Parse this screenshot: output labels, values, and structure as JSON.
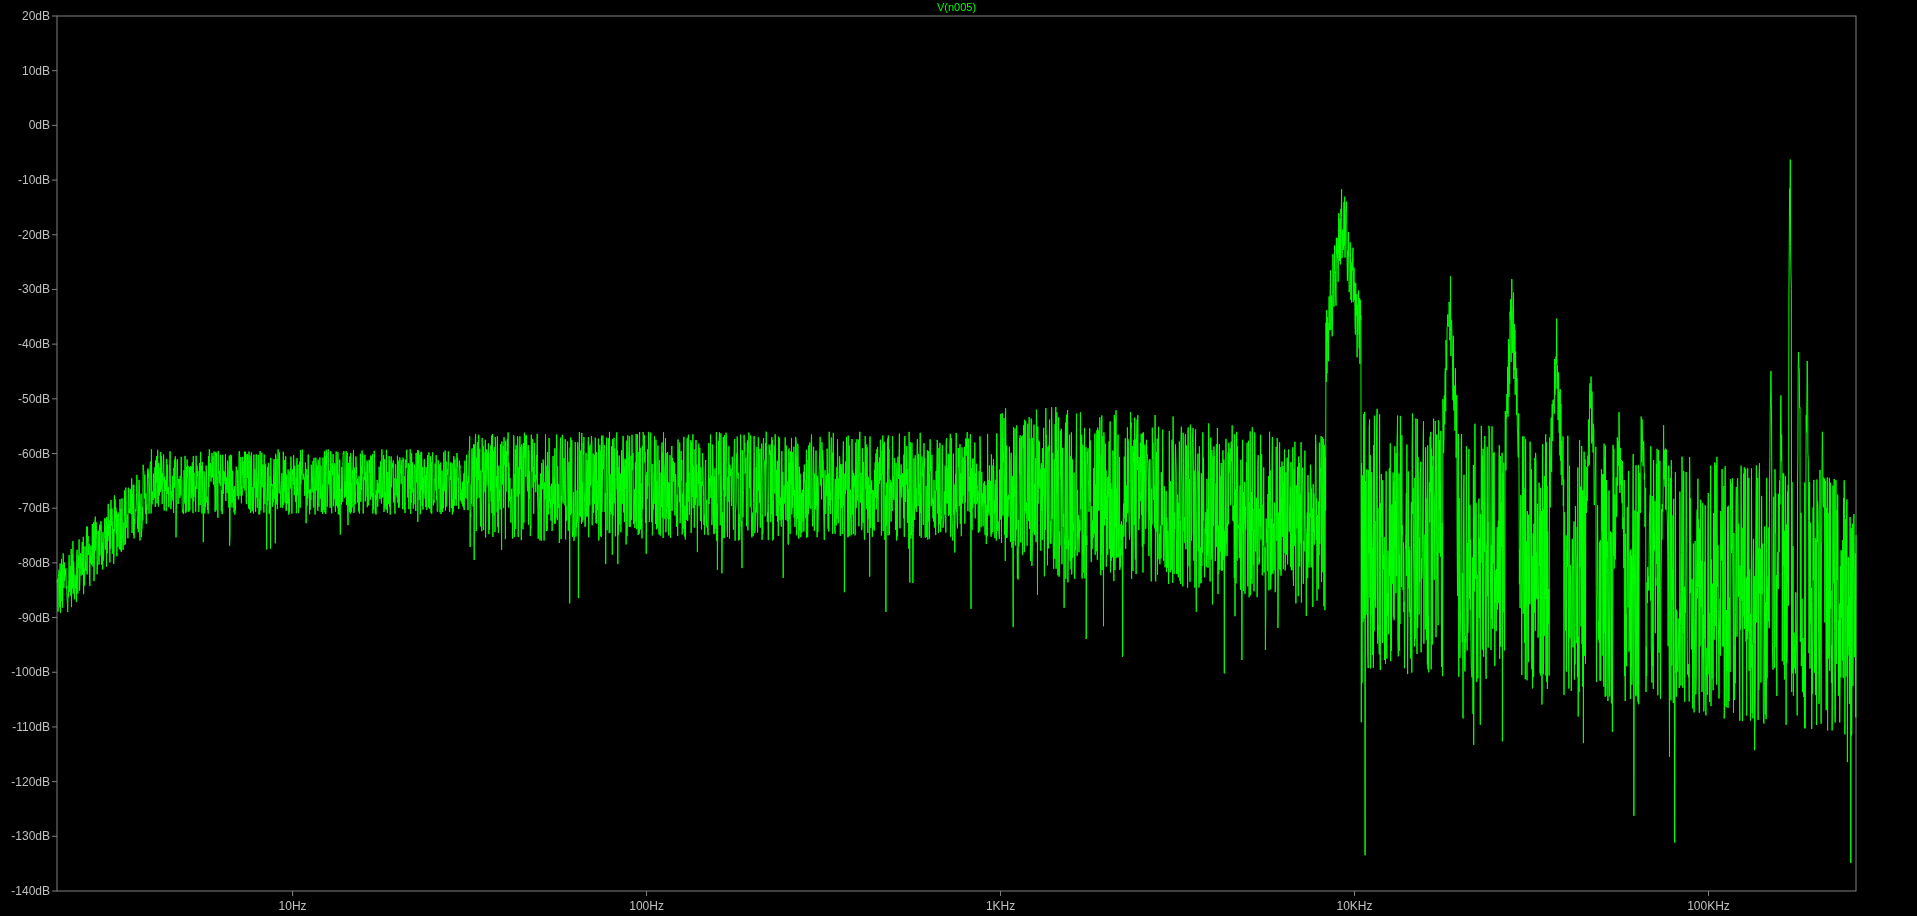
{
  "plot": {
    "trace_name": "V(n005)",
    "y_axis_labels": [
      "20dB",
      "10dB",
      "0dB",
      "-10dB",
      "-20dB",
      "-30dB",
      "-40dB",
      "-50dB",
      "-60dB",
      "-70dB",
      "-80dB",
      "-90dB",
      "-100dB",
      "-110dB",
      "-120dB",
      "-130dB",
      "-140dB"
    ],
    "x_axis_labels": [
      "10Hz",
      "100Hz",
      "1KHz",
      "10KHz",
      "100KHz"
    ]
  }
}
